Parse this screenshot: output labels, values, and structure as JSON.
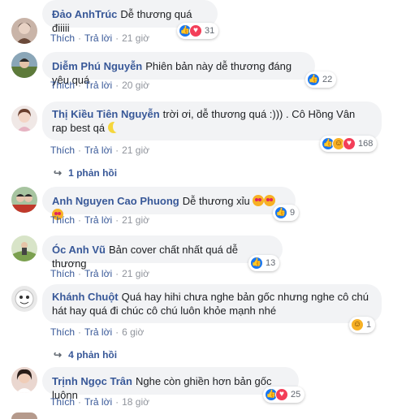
{
  "actions": {
    "like": "Thích",
    "reply": "Trả lời",
    "sep": "·"
  },
  "comments": [
    {
      "author": "Đảo AnhTrúc",
      "text": "Dễ thương quá điiiii",
      "time": "21 giờ",
      "reactions": [
        "like",
        "love"
      ],
      "count": "31"
    },
    {
      "author": "Diễm Phú Nguyễn",
      "text": "Phiên bản này dễ thương đáng yêu quá",
      "time": "20 giờ",
      "reactions": [
        "like"
      ],
      "count": "22"
    },
    {
      "author": "Thị Kiều Tiên Nguyễn",
      "text": "trời ơi, dễ thương quá :))) . Cô Hồng Vân rap best qá",
      "time": "21 giờ",
      "reactions": [
        "like",
        "haha",
        "love"
      ],
      "count": "168",
      "replies": "1 phản hồi"
    },
    {
      "author": "Anh Nguyen Cao Phuong",
      "text": "Dễ thương xỉu",
      "time": "21 giờ",
      "reactions": [
        "like"
      ],
      "count": "9"
    },
    {
      "author": "Óc Anh Vũ",
      "text": "Bản cover chất nhất quá dễ thương",
      "time": "21 giờ",
      "reactions": [
        "like"
      ],
      "count": "13"
    },
    {
      "author": "Khánh Chuột",
      "text": "Quá hay hihi chưa nghe bản gốc nhưng nghe cô chú hát hay quá đi chúc cô chú luôn khỏe mạnh nhé",
      "time": "6 giờ",
      "reactions": [
        "haha"
      ],
      "count": "1",
      "replies": "4 phản hồi"
    },
    {
      "author": "Trịnh Ngọc Trân",
      "text": "Nghe còn ghiền hơn bản gốc luônn",
      "time": "18 giờ",
      "reactions": [
        "like",
        "love"
      ],
      "count": "25"
    }
  ],
  "colors": {
    "link": "#385898",
    "bubble": "#f2f3f5",
    "like": "#1877f2",
    "love": "#f33e58",
    "haha": "#f7b125"
  },
  "icons": {
    "like": "thumbs-up-icon",
    "love": "heart-icon",
    "haha": "laughing-face-icon",
    "reply_arrow": "reply-arrow-icon"
  }
}
